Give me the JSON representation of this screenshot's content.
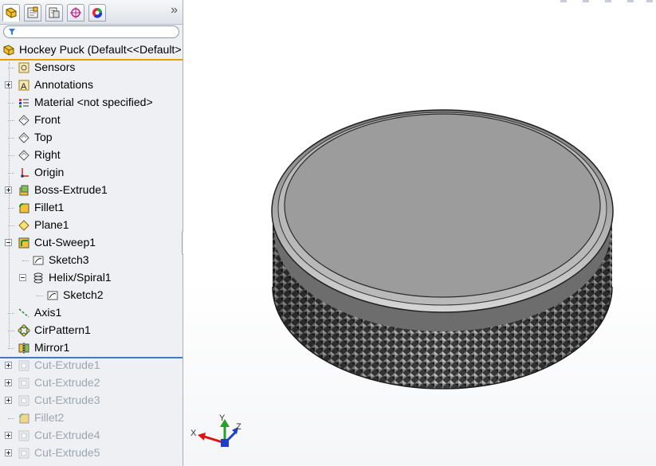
{
  "panel": {
    "tabs": [
      {
        "name": "featuremanager-tab"
      },
      {
        "name": "propertymanager-tab"
      },
      {
        "name": "configurationmanager-tab"
      },
      {
        "name": "dimxpert-tab"
      },
      {
        "name": "display-manager-tab"
      }
    ],
    "more_glyph": "»",
    "root_label": "Hockey Puck  (Default<<Default>",
    "tree": [
      {
        "label": "Sensors",
        "icon": "sensors-icon"
      },
      {
        "label": "Annotations",
        "icon": "annotations-icon",
        "expander": "plus"
      },
      {
        "label": "Material <not specified>",
        "icon": "material-icon"
      },
      {
        "label": "Front",
        "icon": "plane-icon"
      },
      {
        "label": "Top",
        "icon": "plane-icon"
      },
      {
        "label": "Right",
        "icon": "plane-icon"
      },
      {
        "label": "Origin",
        "icon": "origin-icon"
      },
      {
        "label": "Boss-Extrude1",
        "icon": "boss-extrude-icon",
        "expander": "plus"
      },
      {
        "label": "Fillet1",
        "icon": "fillet-icon"
      },
      {
        "label": "Plane1",
        "icon": "plane-feature-icon"
      },
      {
        "label": "Cut-Sweep1",
        "icon": "cut-sweep-icon",
        "expander": "minus"
      },
      {
        "label": "Sketch3",
        "icon": "sketch-icon"
      },
      {
        "label": "Helix/Spiral1",
        "icon": "helix-icon",
        "expander": "minus"
      },
      {
        "label": "Sketch2",
        "icon": "sketch-icon"
      },
      {
        "label": "Axis1",
        "icon": "axis-icon"
      },
      {
        "label": "CirPattern1",
        "icon": "circular-pattern-icon"
      },
      {
        "label": "Mirror1",
        "icon": "mirror-icon"
      },
      {
        "label": "Cut-Extrude1",
        "icon": "cut-extrude-icon",
        "expander": "plus",
        "suppressed": true
      },
      {
        "label": "Cut-Extrude2",
        "icon": "cut-extrude-icon",
        "expander": "plus",
        "suppressed": true
      },
      {
        "label": "Cut-Extrude3",
        "icon": "cut-extrude-icon",
        "expander": "plus",
        "suppressed": true
      },
      {
        "label": "Fillet2",
        "icon": "fillet-icon",
        "suppressed": true
      },
      {
        "label": "Cut-Extrude4",
        "icon": "cut-extrude-icon",
        "expander": "plus",
        "suppressed": true
      },
      {
        "label": "Cut-Extrude5",
        "icon": "cut-extrude-icon",
        "expander": "plus",
        "suppressed": true
      }
    ]
  },
  "triad": {
    "x": "X",
    "y": "Y",
    "z": "Z"
  },
  "colors": {
    "rollback_bar": "#4b76c4",
    "root_underline": "#e3a000",
    "puck_top": "#9c9c9c",
    "knurl_dark": "#2a2a2a"
  }
}
